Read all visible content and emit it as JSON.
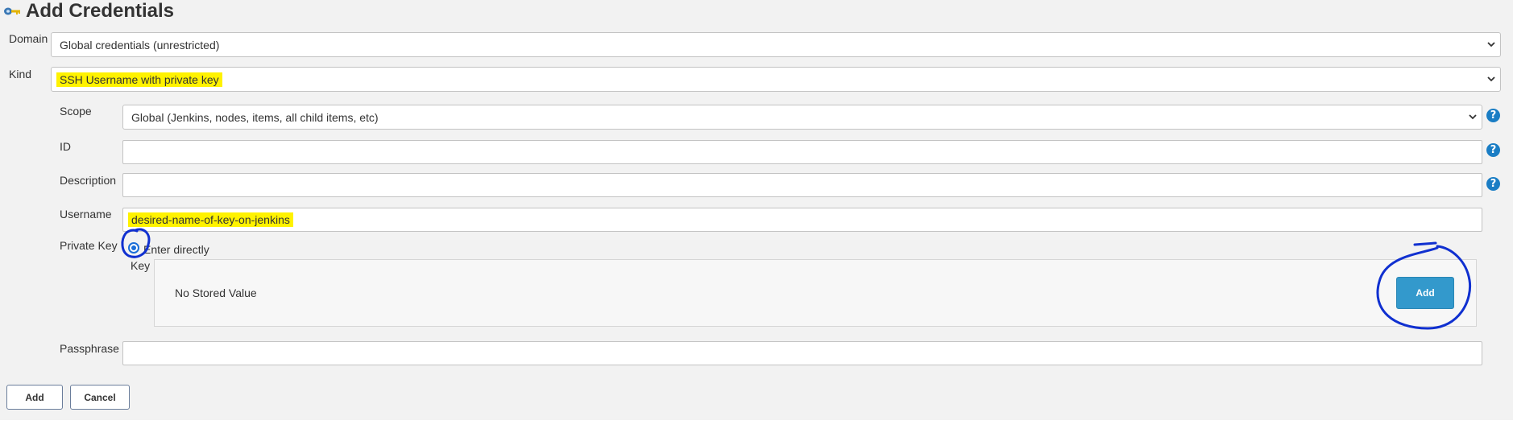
{
  "page": {
    "title": "Add Credentials",
    "title_icon": "credentials-key-icon"
  },
  "form": {
    "domain": {
      "label": "Domain",
      "value": "Global credentials (unrestricted)"
    },
    "kind": {
      "label": "Kind",
      "value": "SSH Username with private key"
    },
    "scope": {
      "label": "Scope",
      "value": "Global (Jenkins, nodes, items, all child items, etc)"
    },
    "id": {
      "label": "ID",
      "value": ""
    },
    "description": {
      "label": "Description",
      "value": ""
    },
    "username": {
      "label": "Username",
      "value": "desired-name-of-key-on-jenkins"
    },
    "private_key": {
      "label": "Private Key",
      "option_label": "Enter directly",
      "selected": true,
      "key_label": "Key",
      "key_status": "No Stored Value",
      "add_button": "Add"
    },
    "passphrase": {
      "label": "Passphrase",
      "value": ""
    },
    "help_icon": "?"
  },
  "actions": {
    "add_label": "Add",
    "cancel_label": "Cancel"
  },
  "colors": {
    "page_bg": "#f2f2f2",
    "highlight": "#fff200",
    "help_blue": "#1a7dc4",
    "add_key_blue": "#3399cc",
    "annotation_blue": "#1030d0"
  }
}
